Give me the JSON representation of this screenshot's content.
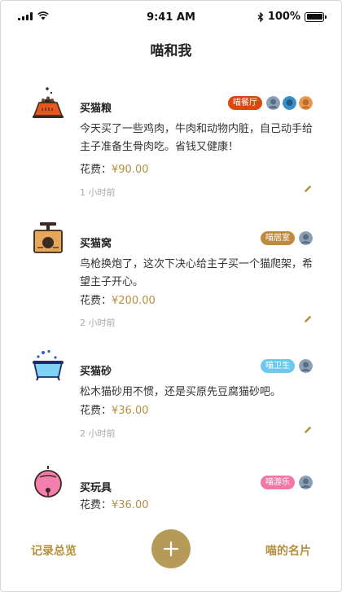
{
  "status_bar": {
    "time": "9:41 AM",
    "battery": "100%",
    "battery_level": 1.0
  },
  "header": {
    "title": "喵和我"
  },
  "cards": [
    {
      "title": "买猫粮",
      "icon": "cat-food-bowl-icon",
      "tag": "喵餐厅",
      "tag_color": "#d9480f",
      "avatar_count": 3,
      "body": "今天买了一些鸡肉，牛肉和动物内脏，自己动手给主子准备生骨肉吃。省钱又健康！",
      "cost_label": "花费：",
      "cost_value": "¥90.00",
      "time": "1 小时前"
    },
    {
      "title": "买猫窝",
      "icon": "cat-house-icon",
      "tag": "喵居室",
      "tag_color": "#c08a3e",
      "avatar_count": 1,
      "body": "鸟枪换炮了，这次下决心给主子买一个猫爬架，希望主子开心。",
      "cost_label": "花费：",
      "cost_value": "¥200.00",
      "time": "2 小时前"
    },
    {
      "title": "买猫砂",
      "icon": "litter-box-icon",
      "tag": "喵卫生",
      "tag_color": "#6cc9ec",
      "avatar_count": 1,
      "body": "松木猫砂用不惯，还是买原先豆腐猫砂吧。",
      "cost_label": "花费：",
      "cost_value": "¥36.00",
      "time": "2 小时前"
    },
    {
      "title": "买玩具",
      "icon": "toy-ball-icon",
      "tag": "喵游乐",
      "tag_color": "#f077a6",
      "avatar_count": 1,
      "body": "",
      "cost_label": "花费：",
      "cost_value": "¥36.00",
      "time": ""
    }
  ],
  "bottom_nav": {
    "left": "记录总览",
    "right": "喵的名片",
    "add_icon": "plus-icon"
  },
  "colors": {
    "accent": "#b58f3f",
    "fab": "#b59a58"
  }
}
